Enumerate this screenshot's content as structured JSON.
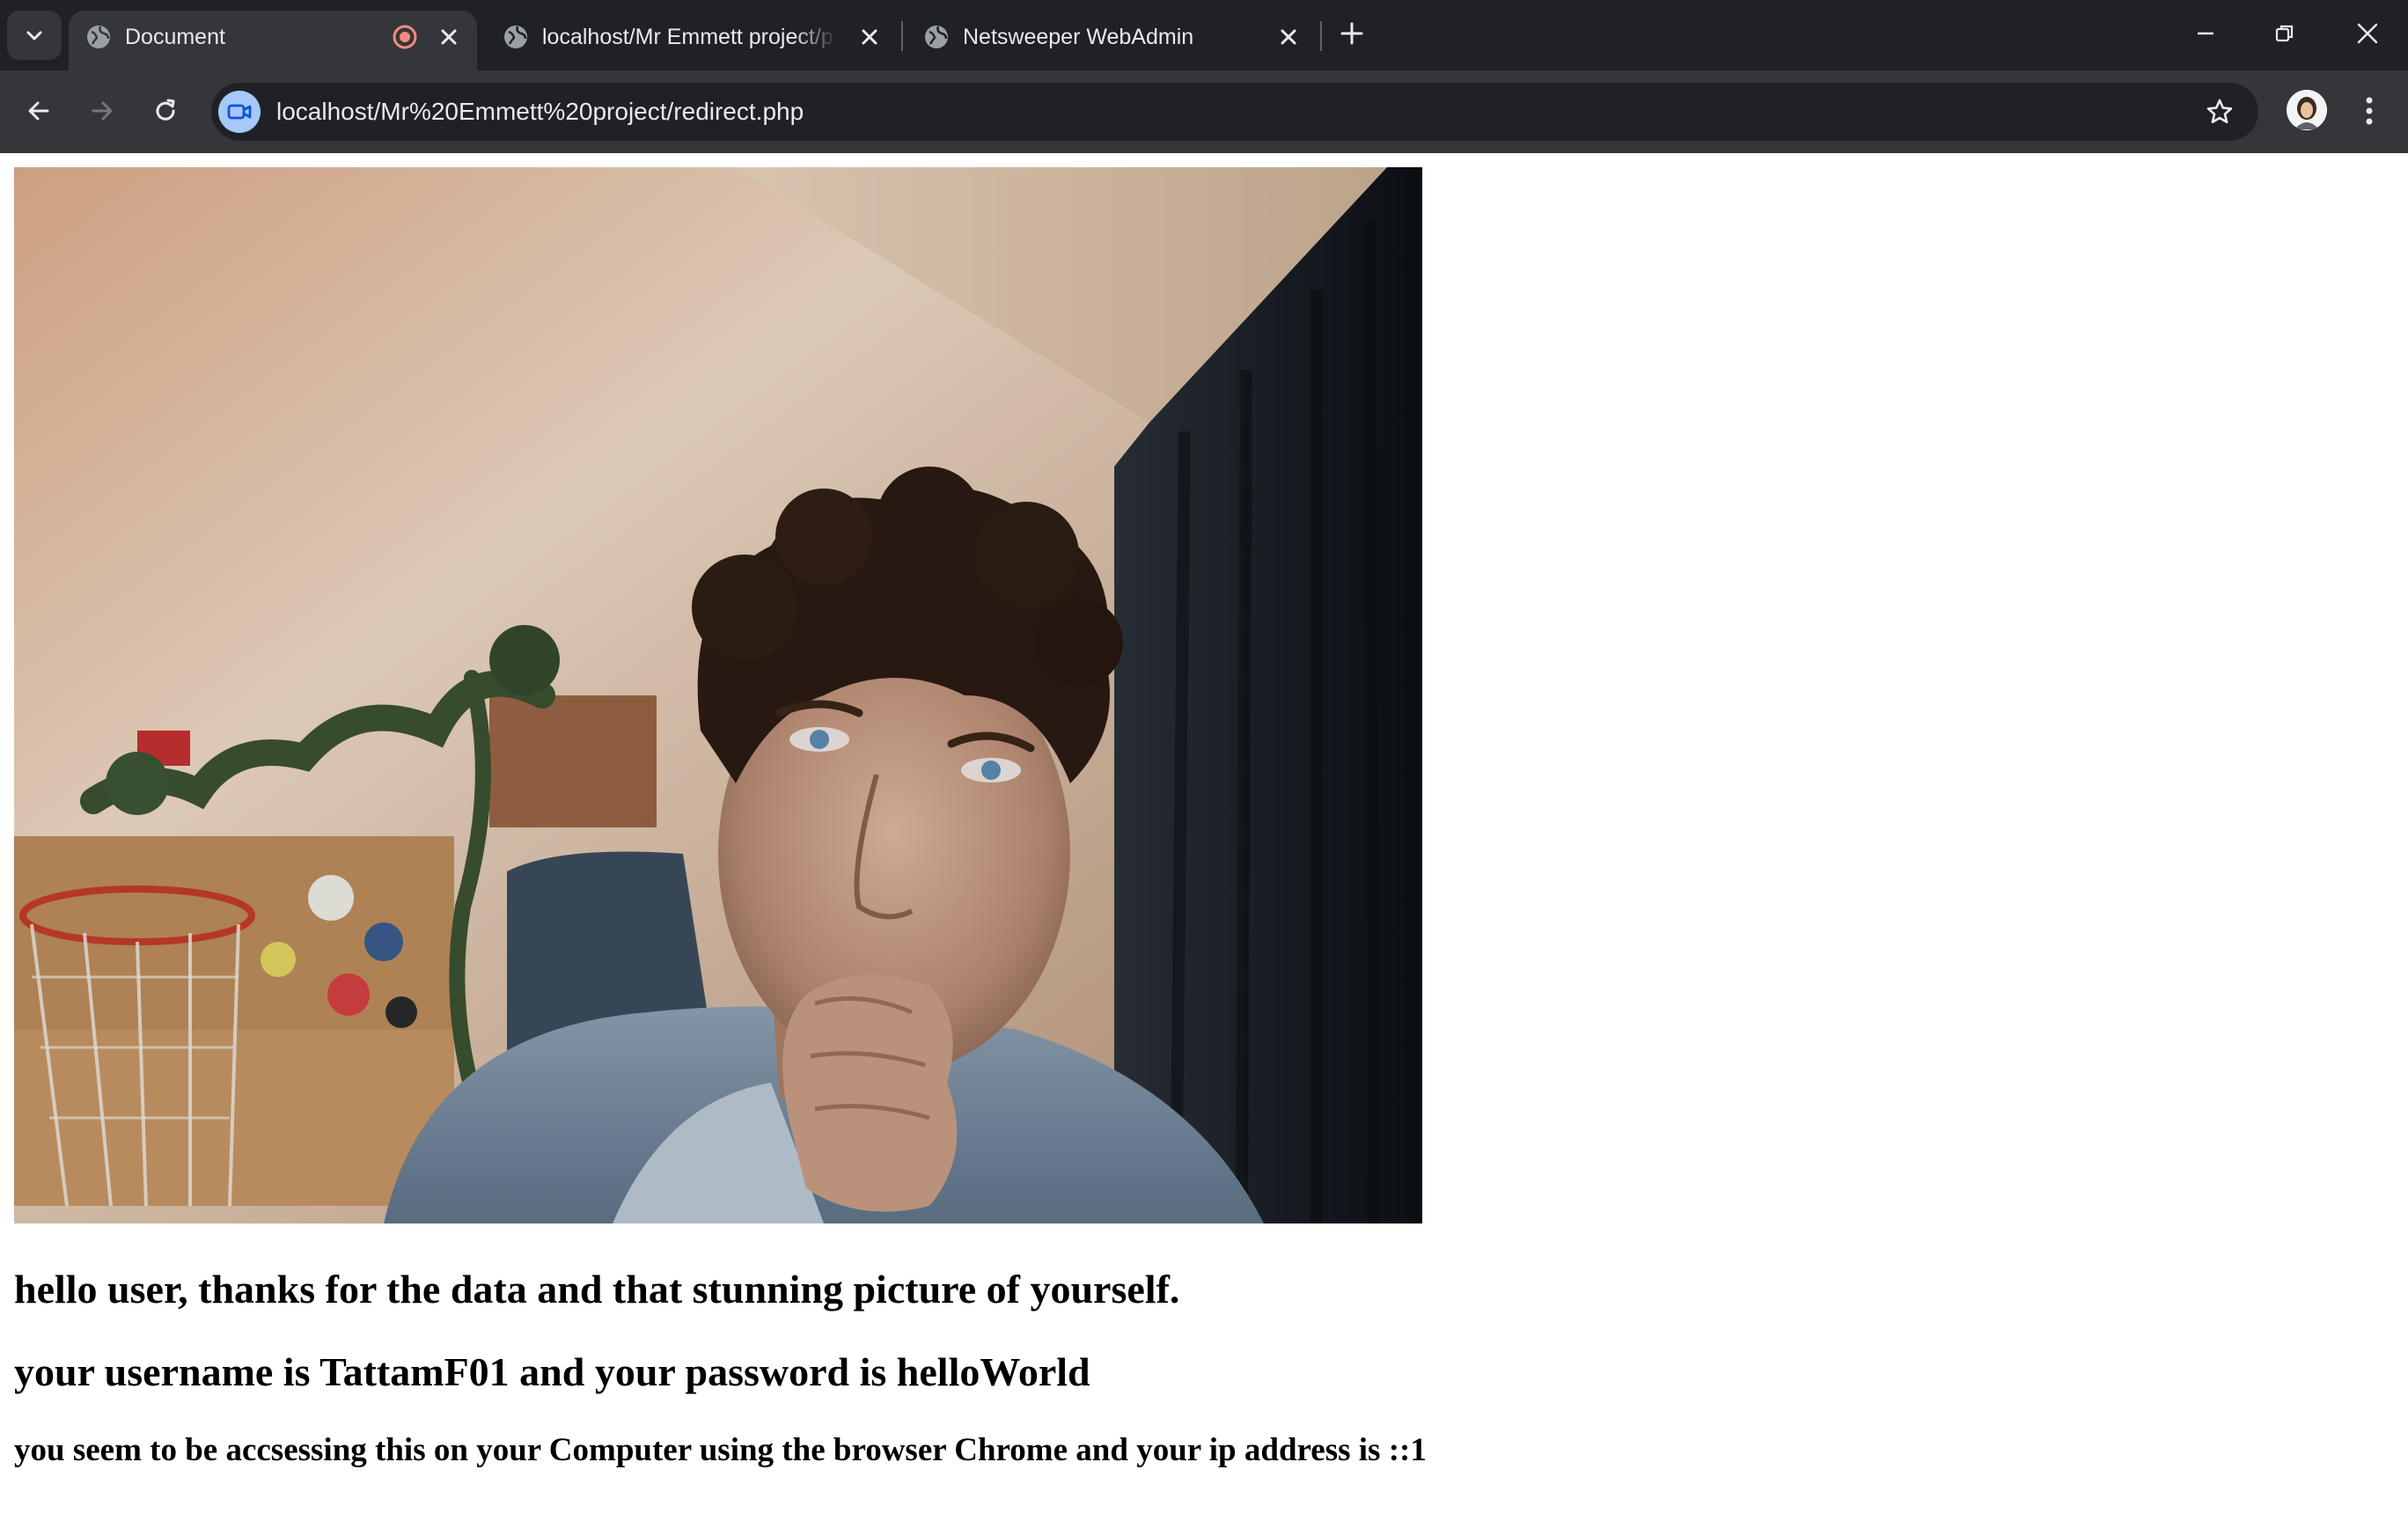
{
  "browser": {
    "tabs": [
      {
        "title": "Document",
        "active": true,
        "recording": true
      },
      {
        "title": "localhost/Mr Emmett project/p",
        "active": false
      },
      {
        "title": "Netsweeper WebAdmin",
        "active": false
      }
    ],
    "address_bar": {
      "url": "localhost/Mr%20Emmett%20project/redirect.php"
    },
    "colors": {
      "tabstrip_bg": "#202124",
      "toolbar_bg": "#35363a",
      "recording_dot": "#f28b82",
      "site_chip": "#a8c7fa"
    },
    "icons": [
      "tab-search-icon",
      "globe-icon",
      "record-icon",
      "close-icon",
      "plus-icon",
      "minimize-icon",
      "restore-icon",
      "back-icon",
      "forward-icon",
      "reload-icon",
      "camera-icon",
      "star-icon",
      "avatar",
      "kebab-menu-icon"
    ]
  },
  "page": {
    "image": {
      "subject": "webcam-photo",
      "description": "webcam photo"
    },
    "messages": [
      "hello user, thanks for the data and that stunning picture of yourself.",
      "your username is TattamF01 and your password is helloWorld",
      "you seem to be accsessing this on your Computer using the browser Chrome and your ip address is ::1"
    ]
  }
}
